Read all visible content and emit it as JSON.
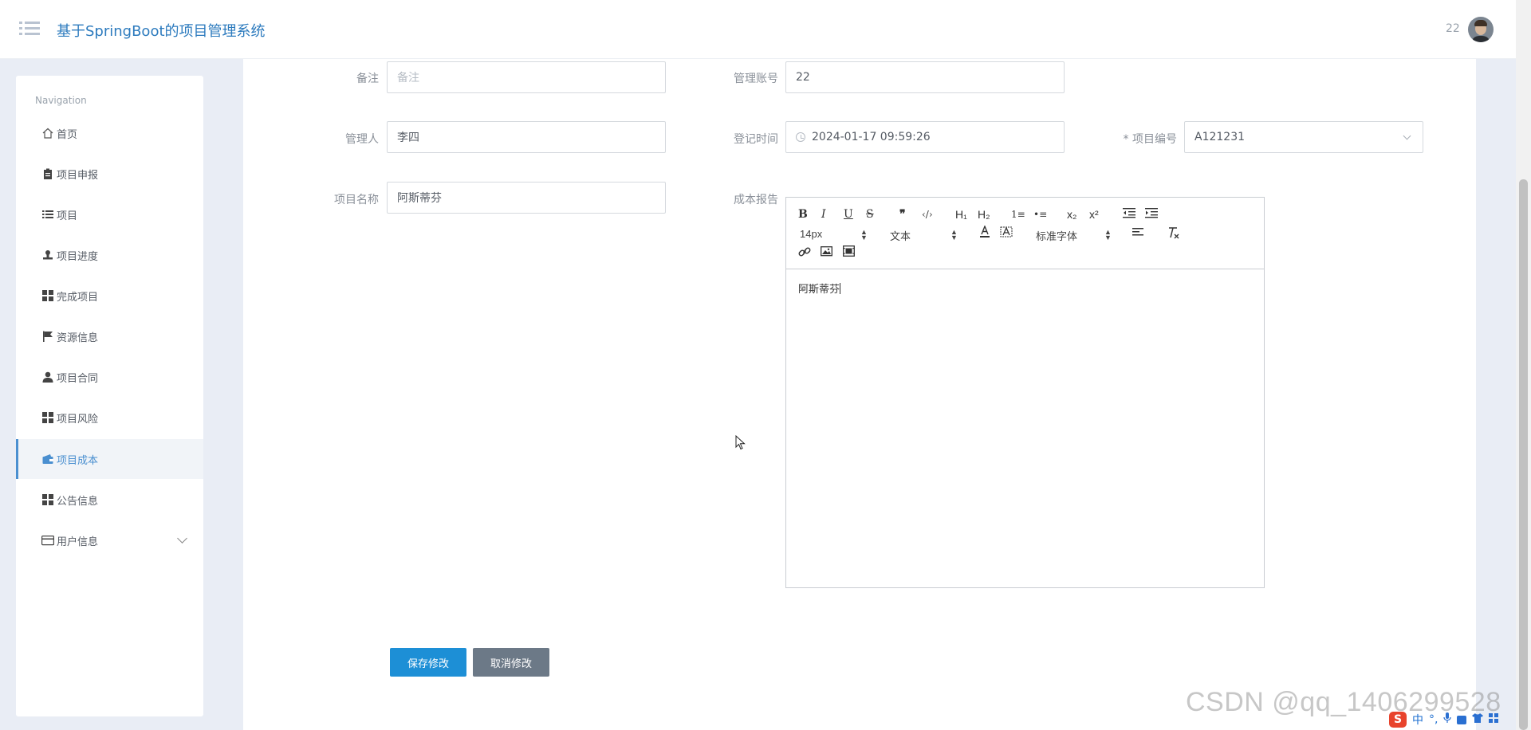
{
  "header": {
    "title": "基于SpringBoot的项目管理系统",
    "username": "22"
  },
  "sidebar": {
    "caption": "Navigation",
    "items": [
      {
        "label": "首页",
        "icon": "home-icon"
      },
      {
        "label": "项目申报",
        "icon": "clipboard-icon"
      },
      {
        "label": "项目",
        "icon": "list-icon"
      },
      {
        "label": "项目进度",
        "icon": "user-stamp-icon"
      },
      {
        "label": "完成项目",
        "icon": "grid-icon"
      },
      {
        "label": "资源信息",
        "icon": "flag-icon"
      },
      {
        "label": "项目合同",
        "icon": "person-icon"
      },
      {
        "label": "项目风险",
        "icon": "grid-icon"
      },
      {
        "label": "项目成本",
        "icon": "wallet-icon",
        "active": true
      },
      {
        "label": "公告信息",
        "icon": "grid-icon"
      },
      {
        "label": "用户信息",
        "icon": "card-icon",
        "expandable": true
      }
    ]
  },
  "form": {
    "remark_label": "备注",
    "remark_placeholder": "备注",
    "manager_account_label": "管理账号",
    "manager_account_value": "22",
    "manager_label": "管理人",
    "manager_value": "李四",
    "register_time_label": "登记时间",
    "register_time_value": "2024-01-17 09:59:26",
    "project_code_label": "* 项目编号",
    "project_code_value": "A121231",
    "project_name_label": "项目名称",
    "project_name_value": "阿斯蒂芬",
    "cost_report_label": "成本报告"
  },
  "editor": {
    "toolbar": {
      "bold": "B",
      "italic": "I",
      "underline": "U",
      "strike": "S",
      "quote": "❞",
      "code": "‹/›",
      "h1": "H₁",
      "h2": "H₂",
      "ol": "1≡",
      "ul": "•≡",
      "sub": "x₂",
      "sup": "x²",
      "size": "14px",
      "text_type": "文本",
      "font_family": "标准字体"
    },
    "content": "阿斯蒂芬"
  },
  "buttons": {
    "save": "保存修改",
    "cancel": "取消修改"
  },
  "watermark": "CSDN @qq_1406299528",
  "ime": {
    "logo": "S",
    "lang": "中",
    "punct": "°,"
  }
}
